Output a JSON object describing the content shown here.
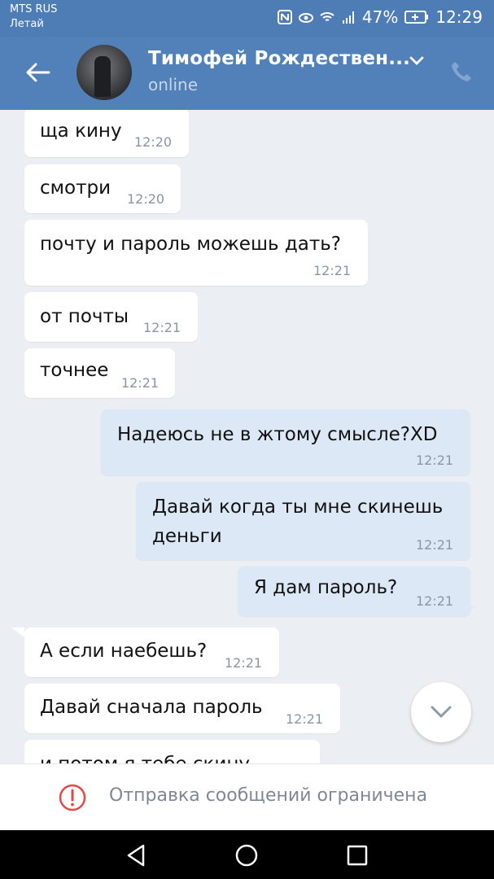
{
  "status_bar": {
    "carrier_line1": "MTS RUS",
    "carrier_line2": "Летай",
    "battery": "47%",
    "time": "12:29"
  },
  "header": {
    "contact_name": "Тимофей Рождествен...",
    "contact_status": "online",
    "accent_color": "#5181b8"
  },
  "messages": [
    {
      "direction": "in",
      "text": "ща кину",
      "time": "12:20"
    },
    {
      "direction": "in",
      "text": "смотри",
      "time": "12:20"
    },
    {
      "direction": "in",
      "text": "почту и пароль можешь дать?",
      "time": "12:21"
    },
    {
      "direction": "in",
      "text": "от почты",
      "time": "12:21"
    },
    {
      "direction": "in",
      "text": "точнее",
      "time": "12:21"
    },
    {
      "direction": "out",
      "text": "Надеюсь не в жтому смысле?XD",
      "time": "12:21"
    },
    {
      "direction": "out",
      "text_line1": "Давай когда ты мне скинешь",
      "text_line2": "деньги",
      "time": "12:21"
    },
    {
      "direction": "out",
      "text": "Я дам пароль?",
      "time": "12:21"
    },
    {
      "direction": "in",
      "text": "А если наебешь?",
      "time": "12:21"
    },
    {
      "direction": "in",
      "text": "Давай сначала пароль",
      "time": "12:21"
    },
    {
      "direction": "in",
      "text": "и потом я тебе скину"
    }
  ],
  "footer": {
    "notice": "Отправка сообщений ограничена",
    "notice_icon_color": "#e64646"
  },
  "icons": [
    "nfc-icon",
    "eye-icon",
    "wifi-icon",
    "signal-icon",
    "battery-icon",
    "back-arrow-icon",
    "chevron-down-icon",
    "phone-icon",
    "scroll-down-icon",
    "warning-icon",
    "nav-back-icon",
    "nav-home-icon",
    "nav-recent-icon"
  ]
}
